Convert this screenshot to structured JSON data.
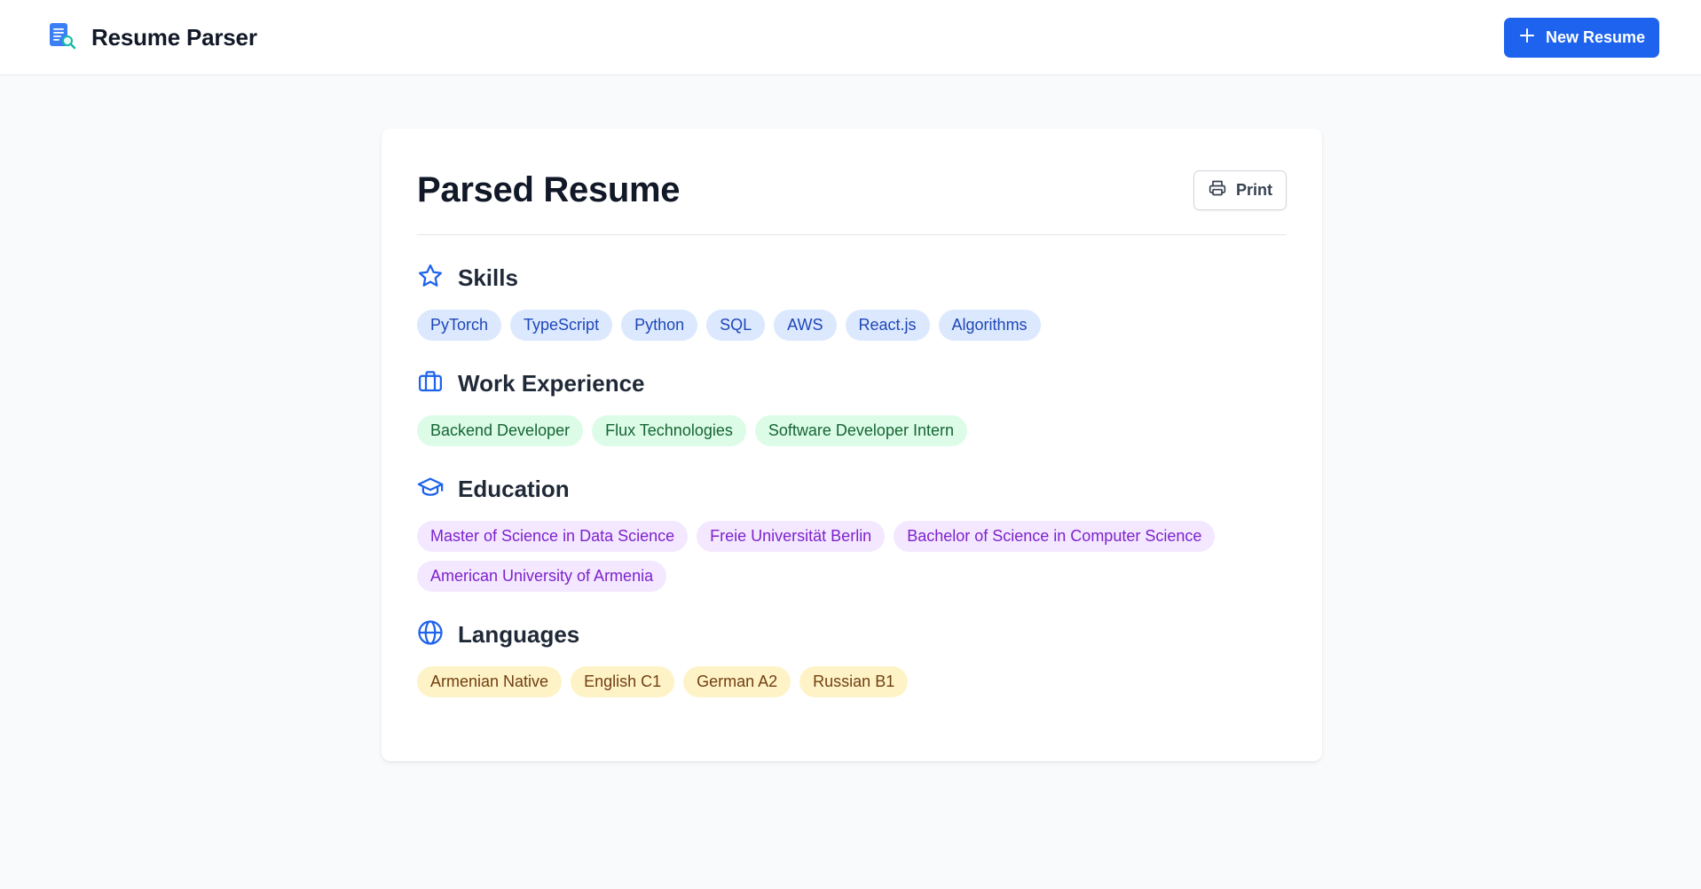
{
  "app": {
    "title": "Resume Parser",
    "logo_icon": "document-search-icon",
    "new_button_label": "New Resume",
    "new_button_icon": "plus-icon"
  },
  "card": {
    "title": "Parsed Resume",
    "print_label": "Print",
    "print_icon": "printer-icon"
  },
  "sections": {
    "skills": {
      "title": "Skills",
      "icon": "star-icon",
      "items": [
        "PyTorch",
        "TypeScript",
        "Python",
        "SQL",
        "AWS",
        "React.js",
        "Algorithms"
      ]
    },
    "work": {
      "title": "Work Experience",
      "icon": "briefcase-icon",
      "items": [
        "Backend Developer",
        "Flux Technologies",
        "Software Developer Intern"
      ]
    },
    "education": {
      "title": "Education",
      "icon": "graduation-cap-icon",
      "items": [
        "Master of Science in Data Science",
        "Freie Universität Berlin",
        "Bachelor of Science in Computer Science",
        "American University of Armenia"
      ]
    },
    "languages": {
      "title": "Languages",
      "icon": "globe-icon",
      "items": [
        "Armenian Native",
        "English C1",
        "German A2",
        "Russian B1"
      ]
    }
  },
  "colors": {
    "accent": "#1d63ed",
    "skills_chip_bg": "#dbe8fe",
    "work_chip_bg": "#dcfce7",
    "education_chip_bg": "#f3e8ff",
    "languages_chip_bg": "#fef3c7"
  }
}
